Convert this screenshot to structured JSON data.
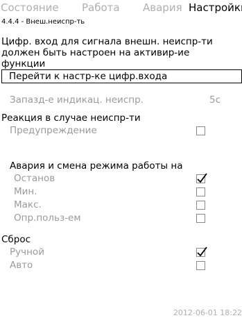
{
  "tabs": [
    "Состояние",
    "Работа",
    "Авария",
    "Настройки"
  ],
  "breadcrumb": "4.4.4 - Внеш.неиспр-ть",
  "description": [
    "Цифр. вход для сигнала внешн. неиспр-ти",
    "должен быть настроен на активир-ие",
    "функции"
  ],
  "goto_button": "Перейти к настр-ке цифр.входа",
  "delay": {
    "label": "Запазд-е индикац. неиспр.",
    "value": "5с"
  },
  "reaction": {
    "header": "Реакция в случае неиспр-ти",
    "warning_label": "Предупреждение",
    "warning_checked": false
  },
  "alarm": {
    "header": "Авария и смена режима работы на",
    "options": [
      {
        "label": "Останов",
        "checked": true
      },
      {
        "label": "Мин.",
        "checked": false
      },
      {
        "label": "Макс.",
        "checked": false
      },
      {
        "label": "Опр.польз-ем",
        "checked": false
      }
    ]
  },
  "reset": {
    "header": "Сброс",
    "options": [
      {
        "label": "Ручной",
        "checked": true
      },
      {
        "label": "Авто",
        "checked": false
      }
    ]
  },
  "timestamp": "2012-06-01 18:22",
  "colors": {
    "inactive_text": "#b0b0b0",
    "muted_text": "#9a9a9a"
  }
}
